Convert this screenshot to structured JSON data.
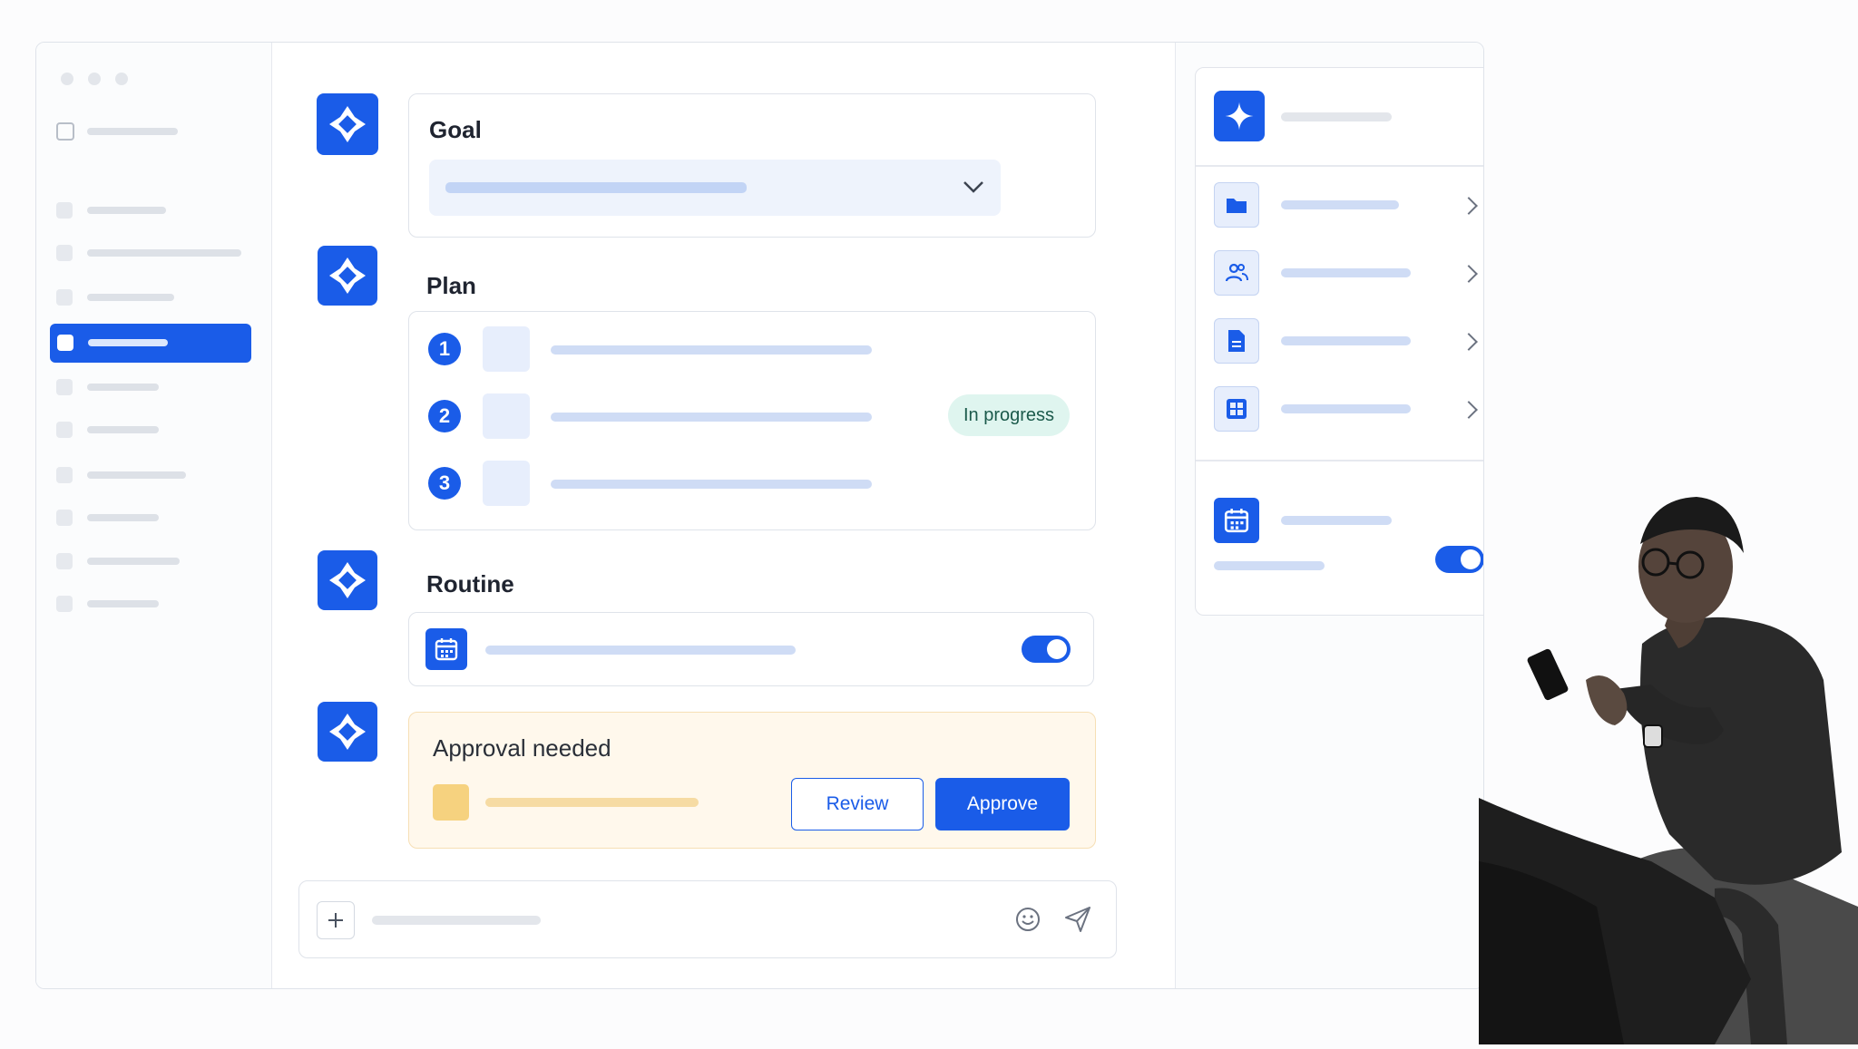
{
  "goal": {
    "heading": "Goal"
  },
  "plan": {
    "heading": "Plan",
    "steps": [
      {
        "number": "1"
      },
      {
        "number": "2",
        "status": "In progress"
      },
      {
        "number": "3"
      }
    ]
  },
  "routine": {
    "heading": "Routine",
    "toggle_on": true
  },
  "approval": {
    "heading": "Approval needed",
    "review_label": "Review",
    "approve_label": "Approve"
  },
  "right_panel": {
    "rows": [
      {
        "icon": "folder-icon"
      },
      {
        "icon": "users-icon"
      },
      {
        "icon": "document-icon"
      },
      {
        "icon": "grid-icon"
      }
    ],
    "schedule": {
      "icon": "calendar-icon",
      "toggle_on": true
    }
  },
  "colors": {
    "accent": "#1a5ce8",
    "status_bg": "#dff5ef",
    "approval_bg": "#fff8ec"
  }
}
